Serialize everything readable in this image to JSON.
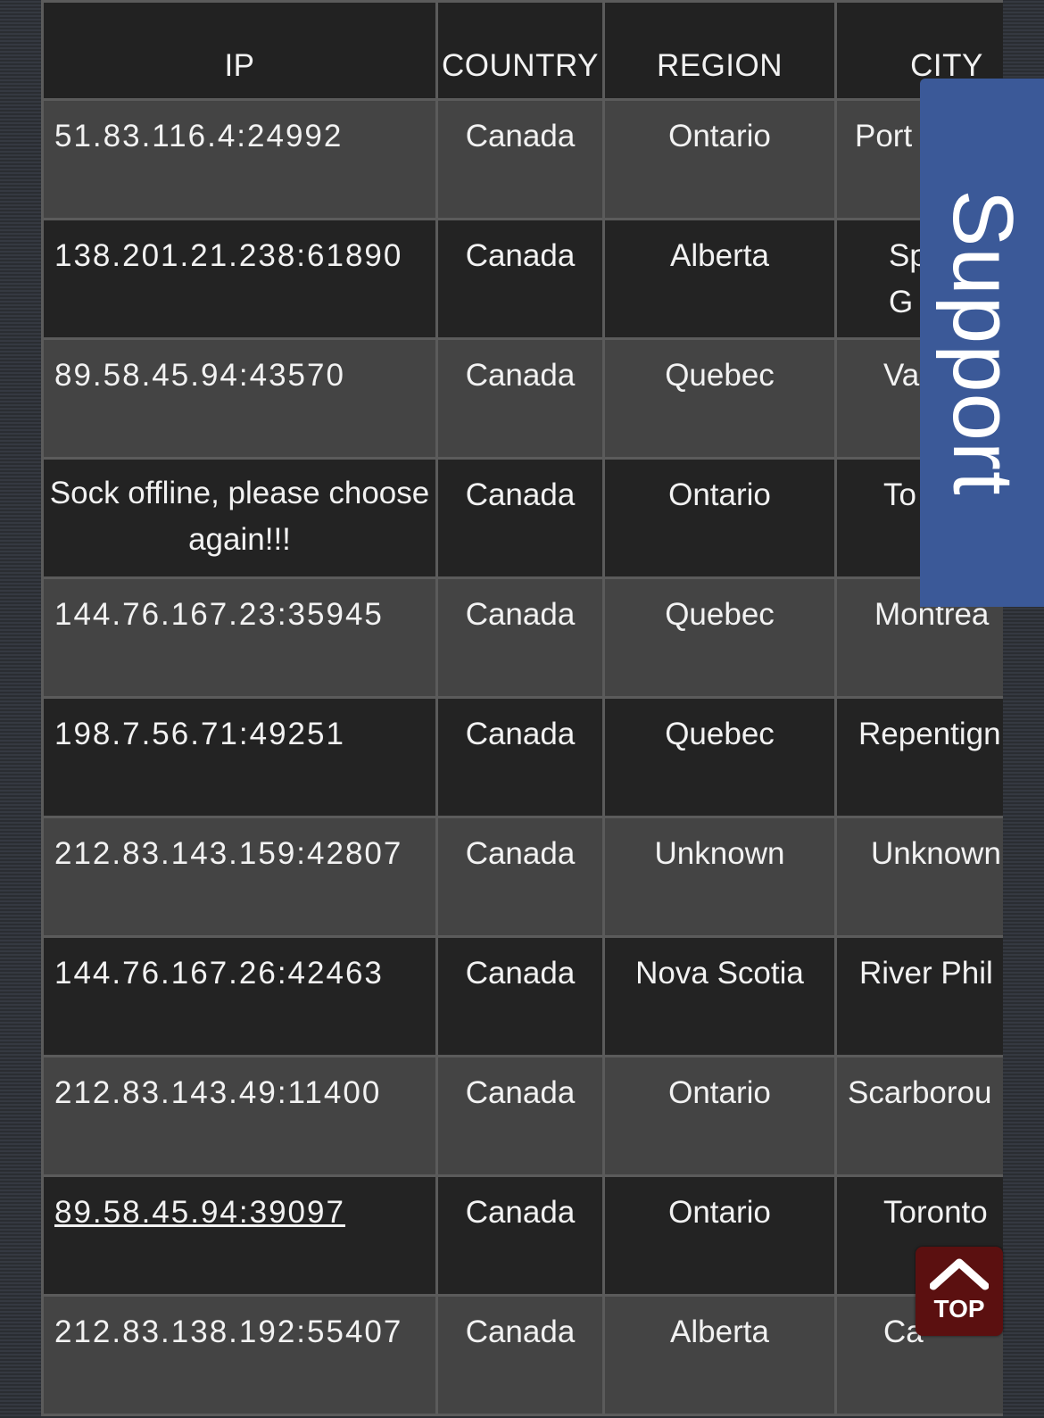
{
  "table": {
    "headers": {
      "ip": "IP",
      "country": "COUNTRY",
      "region": "REGION",
      "city": "CITY"
    },
    "rows": [
      {
        "ip": "51.83.116.4:24992",
        "country": "Canada",
        "region": "Ontario",
        "city": "Port"
      },
      {
        "ip": "138.201.21.238:61890",
        "country": "Canada",
        "region": "Alberta",
        "city": "Sp\nG"
      },
      {
        "ip": "89.58.45.94:43570",
        "country": "Canada",
        "region": "Quebec",
        "city": "Va"
      },
      {
        "ip": "Sock offline, please choose again!!!",
        "country": "Canada",
        "region": "Ontario",
        "city": "To"
      },
      {
        "ip": "144.76.167.23:35945",
        "country": "Canada",
        "region": "Quebec",
        "city": "Montrea"
      },
      {
        "ip": "198.7.56.71:49251",
        "country": "Canada",
        "region": "Quebec",
        "city": "Repentign"
      },
      {
        "ip": "212.83.143.159:42807",
        "country": "Canada",
        "region": "Unknown",
        "city": "Unknown"
      },
      {
        "ip": "144.76.167.26:42463",
        "country": "Canada",
        "region": "Nova Scotia",
        "city": "River Phil"
      },
      {
        "ip": "212.83.143.49:11400",
        "country": "Canada",
        "region": "Ontario",
        "city": "Scarborou"
      },
      {
        "ip": "89.58.45.94:39097",
        "country": "Canada",
        "region": "Ontario",
        "city": "Toronto"
      },
      {
        "ip": "212.83.138.192:55407",
        "country": "Canada",
        "region": "Alberta",
        "city": "Ca"
      }
    ]
  },
  "support_tab": {
    "label": "Support",
    "color": "#3b5998"
  },
  "top_button": {
    "label": "TOP",
    "icon": "chevron-up-icon",
    "color": "#5b1010"
  }
}
